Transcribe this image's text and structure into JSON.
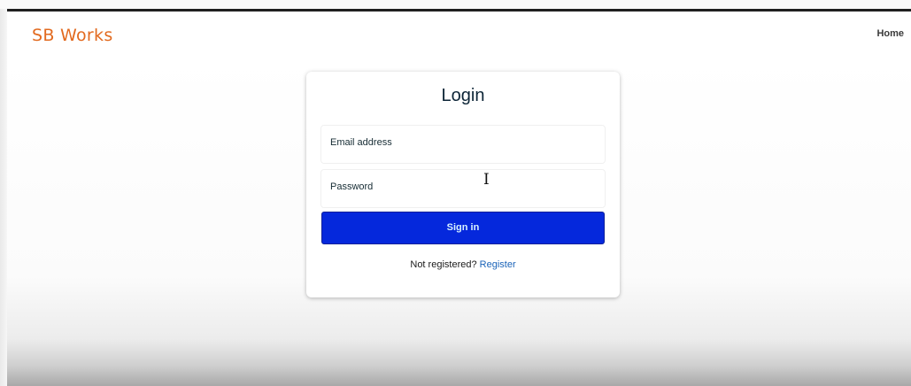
{
  "navbar": {
    "brand": "SB Works",
    "home_link": "Home"
  },
  "login": {
    "title": "Login",
    "email_label": "Email address",
    "password_label": "Password",
    "signin_label": "Sign in",
    "register_prompt": "Not registered? ",
    "register_link": "Register"
  },
  "colors": {
    "brand": "#e26a1f",
    "primary_button": "#0528dc",
    "link": "#1a63b8"
  }
}
